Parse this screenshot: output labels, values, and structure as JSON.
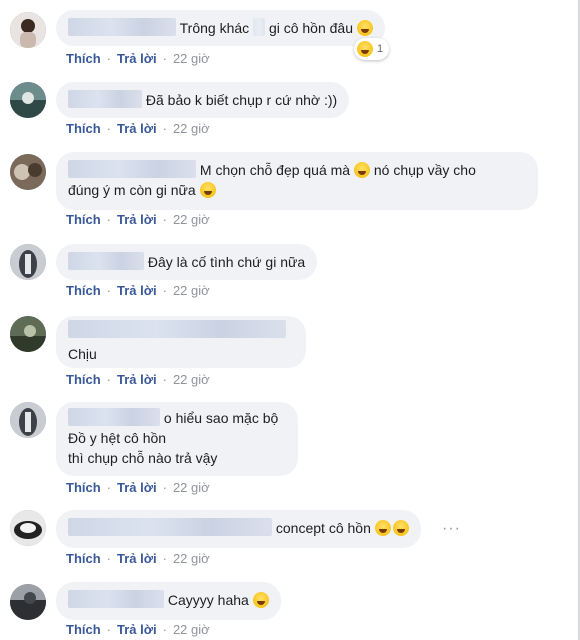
{
  "comments": [
    {
      "text": "Trông khác",
      "text2": "gi cô hồn đâu",
      "time": "22 giờ",
      "reaction_count": "1"
    },
    {
      "text": "Đã bảo k biết chụp r cứ nhờ :))",
      "time": "22 giờ"
    },
    {
      "text": "M chọn chỗ đẹp quá mà",
      "text2": "nó chụp vầy cho",
      "text3": "đúng ý m còn gi nữa",
      "time": "22 giờ"
    },
    {
      "text": "Đây là cố tình chứ gi nữa",
      "time": "22 giờ"
    },
    {
      "text": "Chịu",
      "time": "22 giờ"
    },
    {
      "text": "o hiểu sao mặc bộ",
      "text2": "Đồ y hệt cô hồn",
      "text3": "thì chụp chỗ nào trả vậy",
      "time": "22 giờ"
    },
    {
      "text": "concept cô hồn",
      "time": "22 giờ"
    },
    {
      "text": "Cayyyy haha",
      "time": "22 giờ"
    }
  ],
  "actions": {
    "like": "Thích",
    "reply": "Trả lời"
  },
  "icons": {
    "emoji": "emoji-icon",
    "more": "more-options-icon"
  },
  "colors": {
    "bubble": "#f0f2f5",
    "link": "#385898",
    "meta": "#90949c"
  }
}
